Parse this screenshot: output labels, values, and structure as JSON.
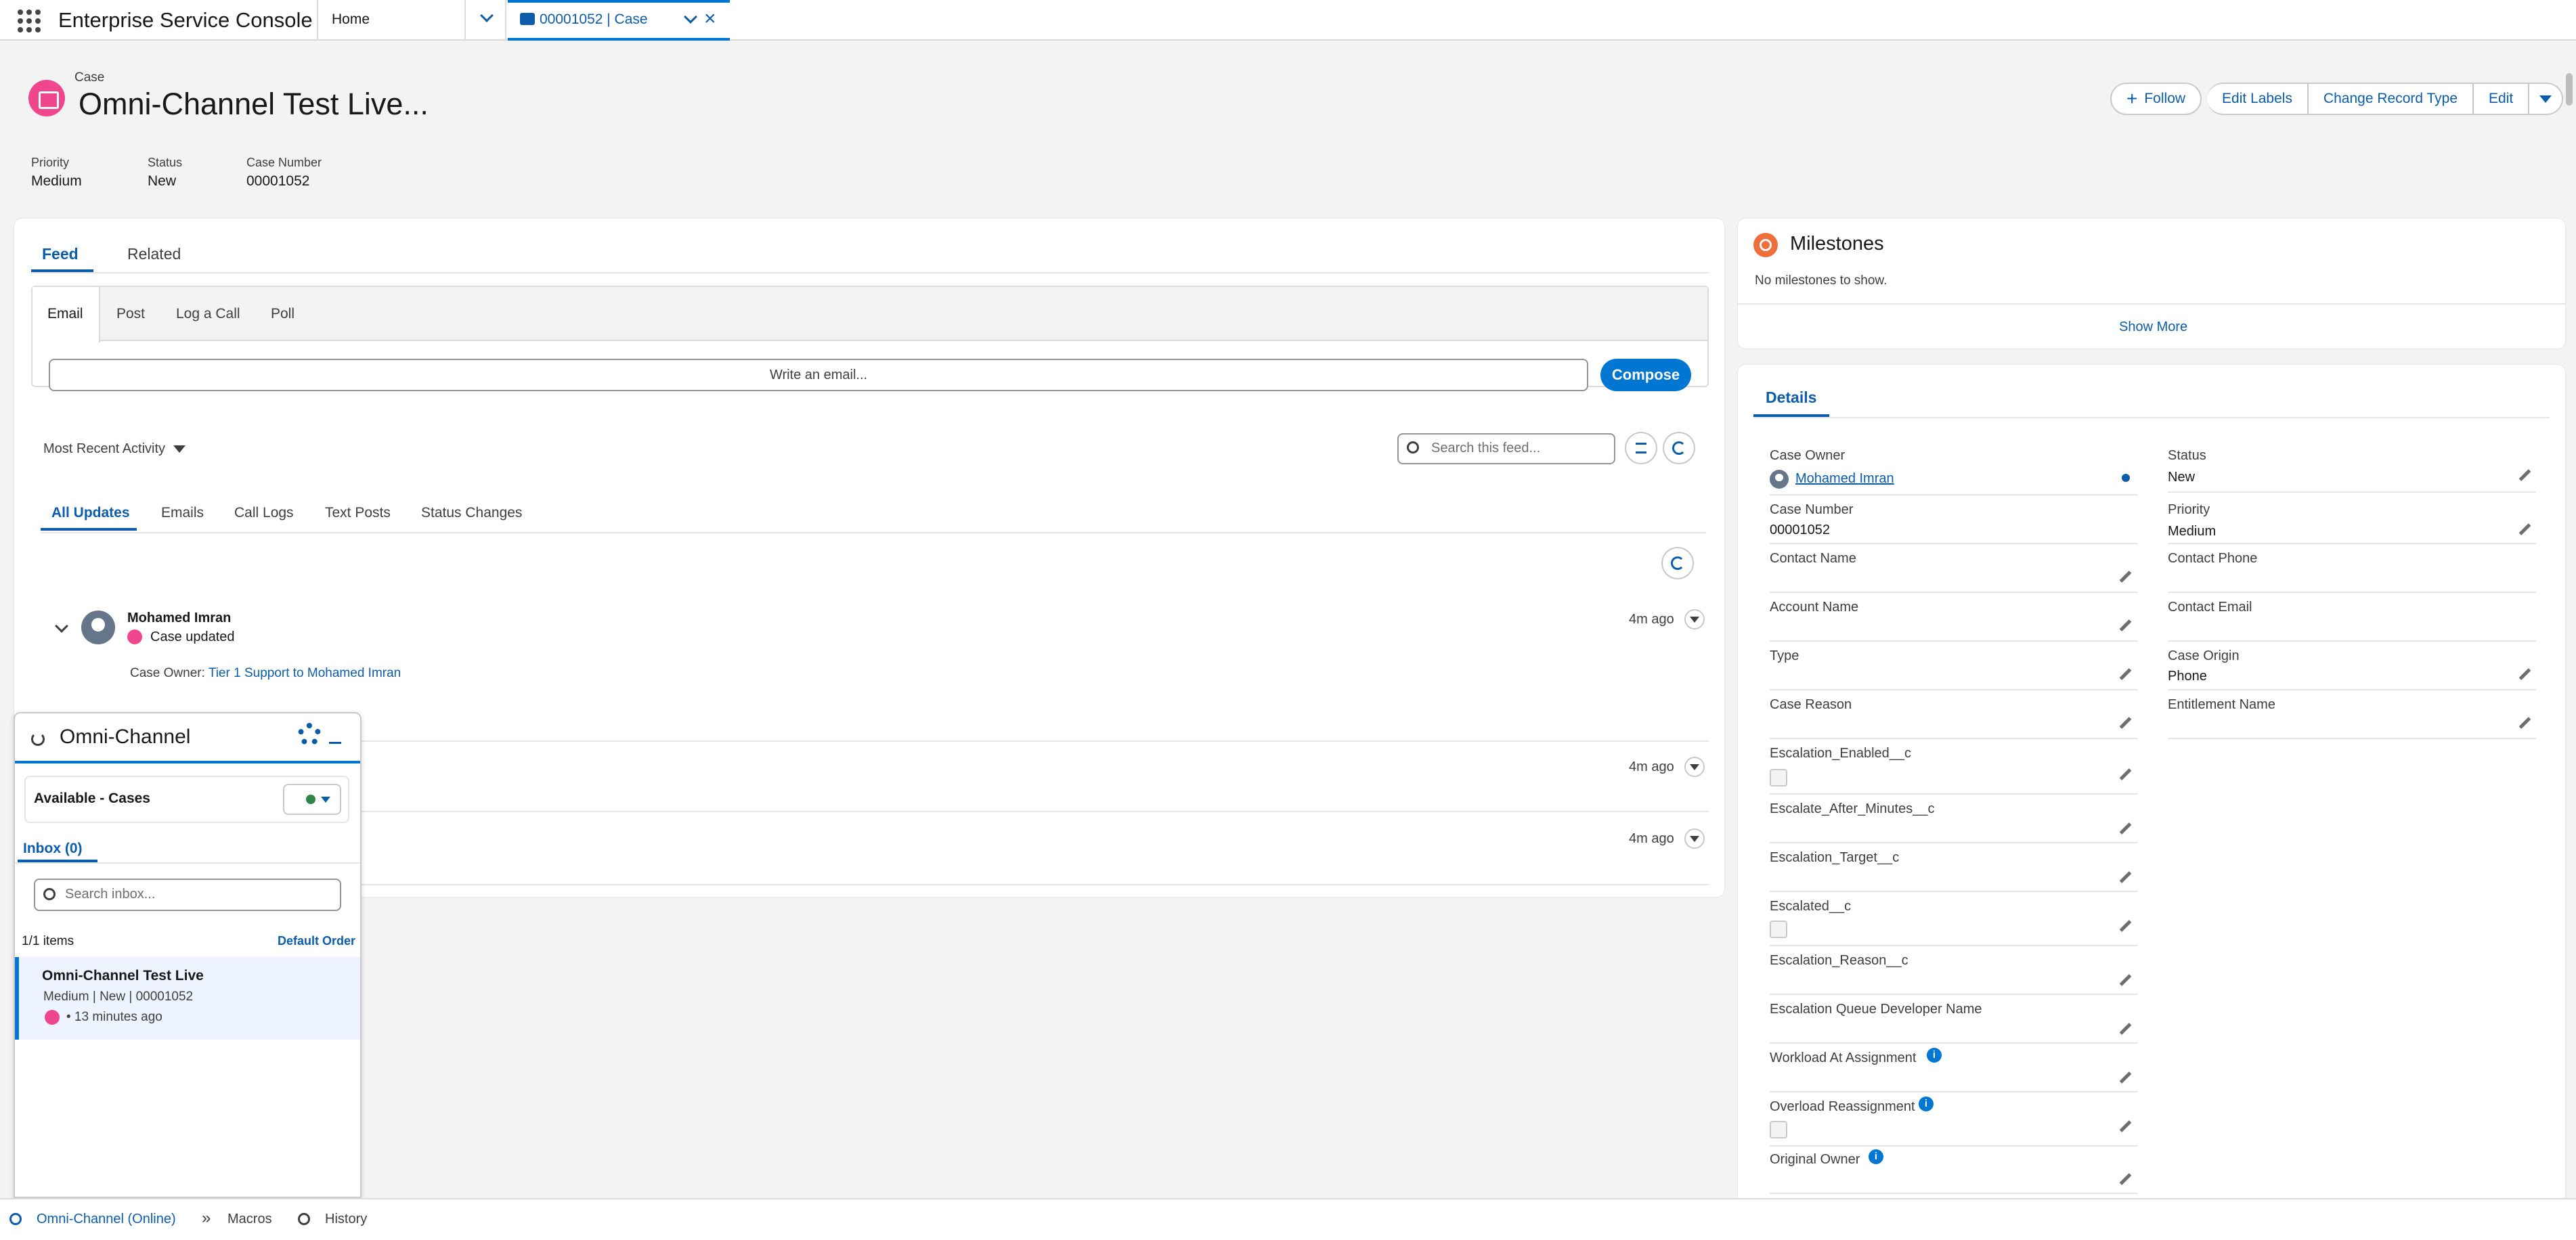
{
  "app": {
    "name": "Enterprise Service Console"
  },
  "tabs": {
    "home": "Home",
    "case": "00001052 | Case"
  },
  "record": {
    "object_label": "Case",
    "title": "Omni-Channel Test Live...",
    "highlights": [
      {
        "label": "Priority",
        "value": "Medium"
      },
      {
        "label": "Status",
        "value": "New"
      },
      {
        "label": "Case Number",
        "value": "00001052"
      }
    ],
    "buttons": {
      "follow": "Follow",
      "edit_labels": "Edit Labels",
      "change_record_type": "Change Record Type",
      "edit": "Edit"
    }
  },
  "feed": {
    "tabs": {
      "feed": "Feed",
      "related": "Related"
    },
    "publisher_tabs": [
      "Email",
      "Post",
      "Log a Call",
      "Poll"
    ],
    "email_placeholder": "Write an email...",
    "compose": "Compose",
    "sort": "Most Recent Activity",
    "search_placeholder": "Search this feed...",
    "filters": [
      "All Updates",
      "Emails",
      "Call Logs",
      "Text Posts",
      "Status Changes"
    ],
    "item": {
      "author": "Mohamed Imran",
      "action": "Case updated",
      "time": "4m ago",
      "change_label": "Case Owner:",
      "change_text": "Tier 1 Support to Mohamed Imran"
    },
    "item_times": [
      "4m ago",
      "4m ago"
    ]
  },
  "milestones": {
    "title": "Milestones",
    "empty": "No milestones to show.",
    "show_more": "Show More"
  },
  "details": {
    "tab": "Details",
    "left": [
      {
        "label": "Case Owner",
        "value": "Mohamed Imran"
      },
      {
        "label": "Case Number",
        "value": "00001052"
      },
      {
        "label": "Contact Name",
        "value": ""
      },
      {
        "label": "Account Name",
        "value": ""
      },
      {
        "label": "Type",
        "value": ""
      },
      {
        "label": "Case Reason",
        "value": ""
      },
      {
        "label": "Escalation_Enabled__c",
        "value": ""
      },
      {
        "label": "Escalate_After_Minutes__c",
        "value": ""
      },
      {
        "label": "Escalation_Target__c",
        "value": ""
      },
      {
        "label": "Escalated__c",
        "value": ""
      },
      {
        "label": "Escalation_Reason__c",
        "value": ""
      },
      {
        "label": "Escalation Queue Developer Name",
        "value": ""
      },
      {
        "label": "Workload At Assignment",
        "value": ""
      },
      {
        "label": "Overload Reassignment",
        "value": ""
      },
      {
        "label": "Original Owner",
        "value": ""
      }
    ],
    "right": [
      {
        "label": "Status",
        "value": "New"
      },
      {
        "label": "Priority",
        "value": "Medium"
      },
      {
        "label": "Contact Phone",
        "value": ""
      },
      {
        "label": "Contact Email",
        "value": ""
      },
      {
        "label": "Case Origin",
        "value": "Phone"
      },
      {
        "label": "Entitlement Name",
        "value": ""
      }
    ]
  },
  "omni": {
    "title": "Omni-Channel",
    "status": "Available - Cases",
    "status_color": "#2e844a",
    "inbox_tab": "Inbox (0)",
    "search_placeholder": "Search inbox...",
    "count": "1/1 items",
    "order": "Default Order",
    "work_item": {
      "title": "Omni-Channel Test Live",
      "meta": "Medium | New | 00001052",
      "time": "• 13 minutes ago"
    }
  },
  "utility": {
    "omni": "Omni-Channel (Online)",
    "macros": "Macros",
    "history": "History"
  }
}
